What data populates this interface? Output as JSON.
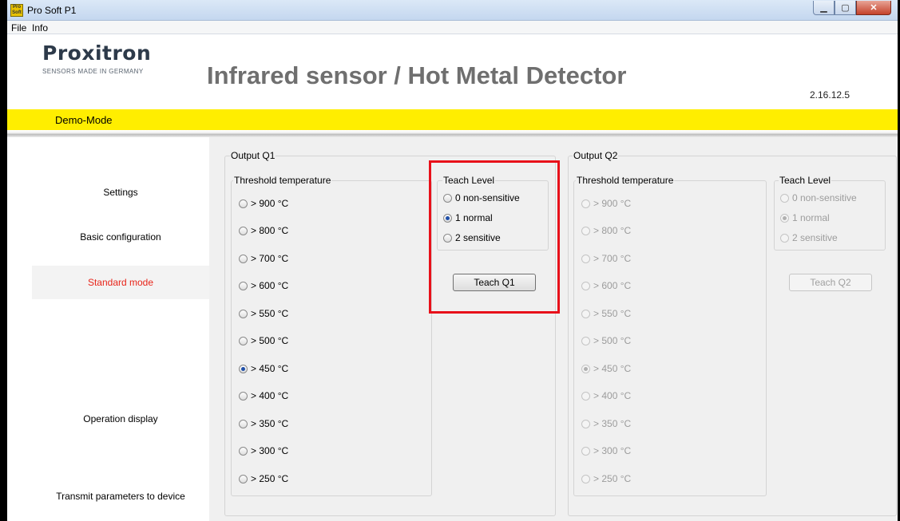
{
  "window": {
    "title": "Pro Soft P1",
    "icon_text": "Pro Soft",
    "controls": [
      "minimize-icon",
      "maximize-icon",
      "close-icon"
    ]
  },
  "menu": {
    "items": [
      "File",
      "Info"
    ]
  },
  "header": {
    "logo": "Proxitron",
    "logo_subtitle": "SENSORS MADE IN GERMANY",
    "title": "Infrared sensor  / Hot Metal Detector",
    "version": "2.16.12.5"
  },
  "mode_bar": {
    "label": "Demo-Mode",
    "color": "#ffee00"
  },
  "nav": {
    "items": [
      {
        "label": "Settings",
        "active": false
      },
      {
        "label": "Basic configuration",
        "active": false
      },
      {
        "label": "Standard mode",
        "active": true
      },
      {
        "label": "Operation display",
        "active": false
      },
      {
        "label": "Transmit parameters to device",
        "active": false
      }
    ],
    "active_color": "#e8251a"
  },
  "output_q1": {
    "title": "Output Q1",
    "threshold": {
      "title": "Threshold temperature",
      "options": [
        "> 900 °C",
        "> 800 °C",
        "> 700 °C",
        "> 600 °C",
        "> 550 °C",
        "> 500 °C",
        "> 450 °C",
        "> 400 °C",
        "> 350 °C",
        "> 300 °C",
        "> 250 °C"
      ],
      "selected": "> 450 °C"
    },
    "teach_level": {
      "title": "Teach Level",
      "options": [
        "0 non-sensitive",
        "1 normal",
        "2 sensitive"
      ],
      "selected": "1 normal"
    },
    "teach_button": "Teach Q1"
  },
  "output_q2": {
    "title": "Output Q2",
    "disabled": true,
    "threshold": {
      "title": "Threshold temperature",
      "options": [
        "> 900 °C",
        "> 800 °C",
        "> 700 °C",
        "> 600 °C",
        "> 550 °C",
        "> 500 °C",
        "> 450 °C",
        "> 400 °C",
        "> 350 °C",
        "> 300 °C",
        "> 250 °C"
      ],
      "selected": "> 450 °C"
    },
    "teach_level": {
      "title": "Teach Level",
      "options": [
        "0 non-sensitive",
        "1 normal",
        "2 sensitive"
      ],
      "selected": "1 normal"
    },
    "teach_button": "Teach Q2"
  },
  "highlight_color": "#e8101a"
}
